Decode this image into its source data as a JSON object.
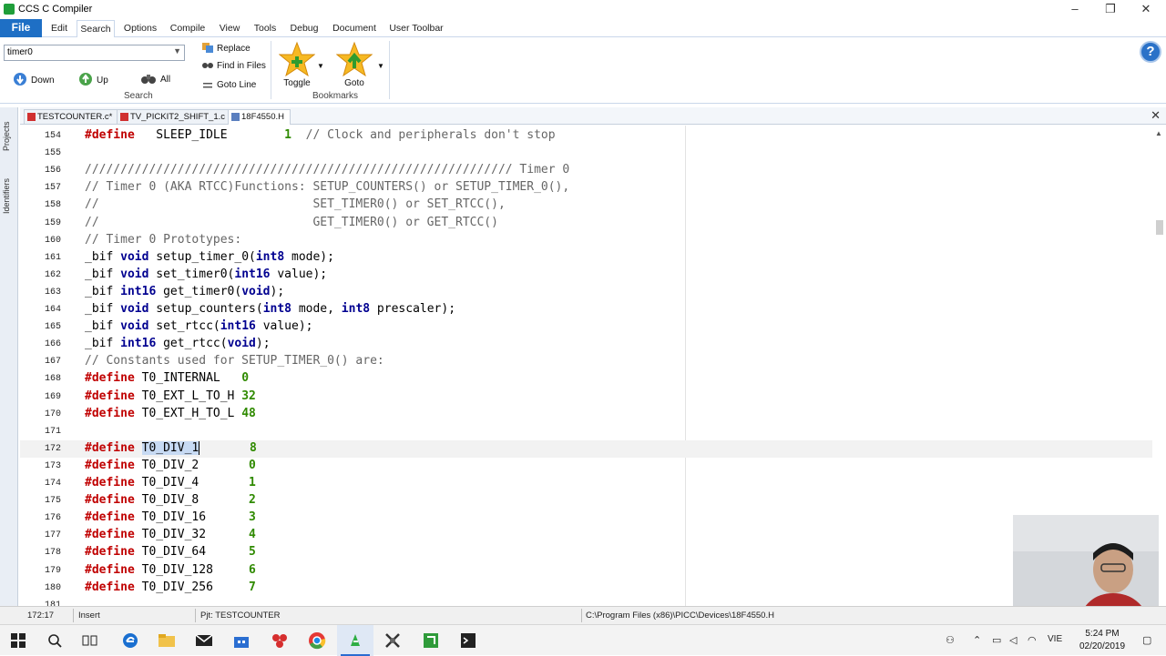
{
  "window": {
    "title": "CCS C Compiler",
    "minimize": "–",
    "restore": "❐",
    "close": "✕"
  },
  "ribbon_tabs": [
    "File",
    "Edit",
    "Search",
    "Options",
    "Compile",
    "View",
    "Tools",
    "Debug",
    "Document",
    "User Toolbar"
  ],
  "active_ribbon_tab": "Search",
  "search_group": {
    "query": "timer0",
    "down": "Down",
    "up": "Up",
    "all": "All",
    "replace": "Replace",
    "find_in_files": "Find in Files",
    "goto_line": "Goto Line",
    "label": "Search"
  },
  "bookmarks_group": {
    "toggle": "Toggle",
    "goto": "Goto",
    "label": "Bookmarks"
  },
  "side_tabs": [
    "Projects",
    "Identifiers"
  ],
  "doc_tabs": [
    {
      "label": "TESTCOUNTER.c*",
      "active": false
    },
    {
      "label": "TV_PICKIT2_SHIFT_1.c",
      "active": false
    },
    {
      "label": "18F4550.H",
      "active": true
    }
  ],
  "code_lines": [
    {
      "n": "154",
      "tokens": [
        [
          "kw",
          "#define"
        ],
        [
          "",
          "   SLEEP_IDLE        "
        ],
        [
          "num",
          "1"
        ],
        [
          "cm",
          "  // Clock and peripherals don't stop"
        ]
      ]
    },
    {
      "n": "155",
      "tokens": []
    },
    {
      "n": "156",
      "tokens": [
        [
          "cm",
          "//////////////////////////////////////////////////////////// Timer 0"
        ]
      ]
    },
    {
      "n": "157",
      "tokens": [
        [
          "cm",
          "// Timer 0 (AKA RTCC)Functions: SETUP_COUNTERS() or SETUP_TIMER_0(),"
        ]
      ]
    },
    {
      "n": "158",
      "tokens": [
        [
          "cm",
          "//                              SET_TIMER0() or SET_RTCC(),"
        ]
      ]
    },
    {
      "n": "159",
      "tokens": [
        [
          "cm",
          "//                              GET_TIMER0() or GET_RTCC()"
        ]
      ]
    },
    {
      "n": "160",
      "tokens": [
        [
          "cm",
          "// Timer 0 Prototypes:"
        ]
      ]
    },
    {
      "n": "161",
      "tokens": [
        [
          "",
          "_bif "
        ],
        [
          "ty",
          "void"
        ],
        [
          "",
          " setup_timer_0("
        ],
        [
          "ty",
          "int8"
        ],
        [
          "",
          " mode);"
        ]
      ]
    },
    {
      "n": "162",
      "tokens": [
        [
          "",
          "_bif "
        ],
        [
          "ty",
          "void"
        ],
        [
          "",
          " set_timer0("
        ],
        [
          "ty",
          "int16"
        ],
        [
          "",
          " value);"
        ]
      ]
    },
    {
      "n": "163",
      "tokens": [
        [
          "",
          "_bif "
        ],
        [
          "ty",
          "int16"
        ],
        [
          "",
          " get_timer0("
        ],
        [
          "ty",
          "void"
        ],
        [
          "",
          ");"
        ]
      ]
    },
    {
      "n": "164",
      "tokens": [
        [
          "",
          "_bif "
        ],
        [
          "ty",
          "void"
        ],
        [
          "",
          " setup_counters("
        ],
        [
          "ty",
          "int8"
        ],
        [
          "",
          " mode, "
        ],
        [
          "ty",
          "int8"
        ],
        [
          "",
          " prescaler);"
        ]
      ]
    },
    {
      "n": "165",
      "tokens": [
        [
          "",
          "_bif "
        ],
        [
          "ty",
          "void"
        ],
        [
          "",
          " set_rtcc("
        ],
        [
          "ty",
          "int16"
        ],
        [
          "",
          " value);"
        ]
      ]
    },
    {
      "n": "166",
      "tokens": [
        [
          "",
          "_bif "
        ],
        [
          "ty",
          "int16"
        ],
        [
          "",
          " get_rtcc("
        ],
        [
          "ty",
          "void"
        ],
        [
          "",
          ");"
        ]
      ]
    },
    {
      "n": "167",
      "tokens": [
        [
          "cm",
          "// Constants used for SETUP_TIMER_0() are:"
        ]
      ]
    },
    {
      "n": "168",
      "tokens": [
        [
          "kw",
          "#define"
        ],
        [
          "",
          " T0_INTERNAL   "
        ],
        [
          "num",
          "0"
        ]
      ]
    },
    {
      "n": "169",
      "tokens": [
        [
          "kw",
          "#define"
        ],
        [
          "",
          " T0_EXT_L_TO_H "
        ],
        [
          "num",
          "32"
        ]
      ]
    },
    {
      "n": "170",
      "tokens": [
        [
          "kw",
          "#define"
        ],
        [
          "",
          " T0_EXT_H_TO_L "
        ],
        [
          "num",
          "48"
        ]
      ]
    },
    {
      "n": "171",
      "tokens": []
    },
    {
      "n": "172",
      "tokens": [
        [
          "kw",
          "#define"
        ],
        [
          "",
          " "
        ],
        [
          "sel",
          "T0_DIV_1"
        ],
        [
          "",
          "       "
        ],
        [
          "num",
          "8"
        ]
      ]
    },
    {
      "n": "173",
      "tokens": [
        [
          "kw",
          "#define"
        ],
        [
          "",
          " T0_DIV_2       "
        ],
        [
          "num",
          "0"
        ]
      ]
    },
    {
      "n": "174",
      "tokens": [
        [
          "kw",
          "#define"
        ],
        [
          "",
          " T0_DIV_4       "
        ],
        [
          "num",
          "1"
        ]
      ]
    },
    {
      "n": "175",
      "tokens": [
        [
          "kw",
          "#define"
        ],
        [
          "",
          " T0_DIV_8       "
        ],
        [
          "num",
          "2"
        ]
      ]
    },
    {
      "n": "176",
      "tokens": [
        [
          "kw",
          "#define"
        ],
        [
          "",
          " T0_DIV_16      "
        ],
        [
          "num",
          "3"
        ]
      ]
    },
    {
      "n": "177",
      "tokens": [
        [
          "kw",
          "#define"
        ],
        [
          "",
          " T0_DIV_32      "
        ],
        [
          "num",
          "4"
        ]
      ]
    },
    {
      "n": "178",
      "tokens": [
        [
          "kw",
          "#define"
        ],
        [
          "",
          " T0_DIV_64      "
        ],
        [
          "num",
          "5"
        ]
      ]
    },
    {
      "n": "179",
      "tokens": [
        [
          "kw",
          "#define"
        ],
        [
          "",
          " T0_DIV_128     "
        ],
        [
          "num",
          "6"
        ]
      ]
    },
    {
      "n": "180",
      "tokens": [
        [
          "kw",
          "#define"
        ],
        [
          "",
          " T0_DIV_256     "
        ],
        [
          "num",
          "7"
        ]
      ]
    },
    {
      "n": "181",
      "tokens": []
    }
  ],
  "current_line": "172",
  "status": {
    "position": "172:17",
    "mode": "Insert",
    "project": "Pjt: TESTCOUNTER",
    "path": "C:\\Program Files (x86)\\PICC\\Devices\\18F4550.H"
  },
  "taskbar": {
    "time": "5:24 PM",
    "date": "02/20/2019",
    "language": "VIE"
  },
  "colors": {
    "accent": "#1e6fc5",
    "keyword": "#c00000",
    "type": "#000090",
    "number": "#2f8a00",
    "comment": "#666666",
    "selection": "#c7daf3"
  }
}
